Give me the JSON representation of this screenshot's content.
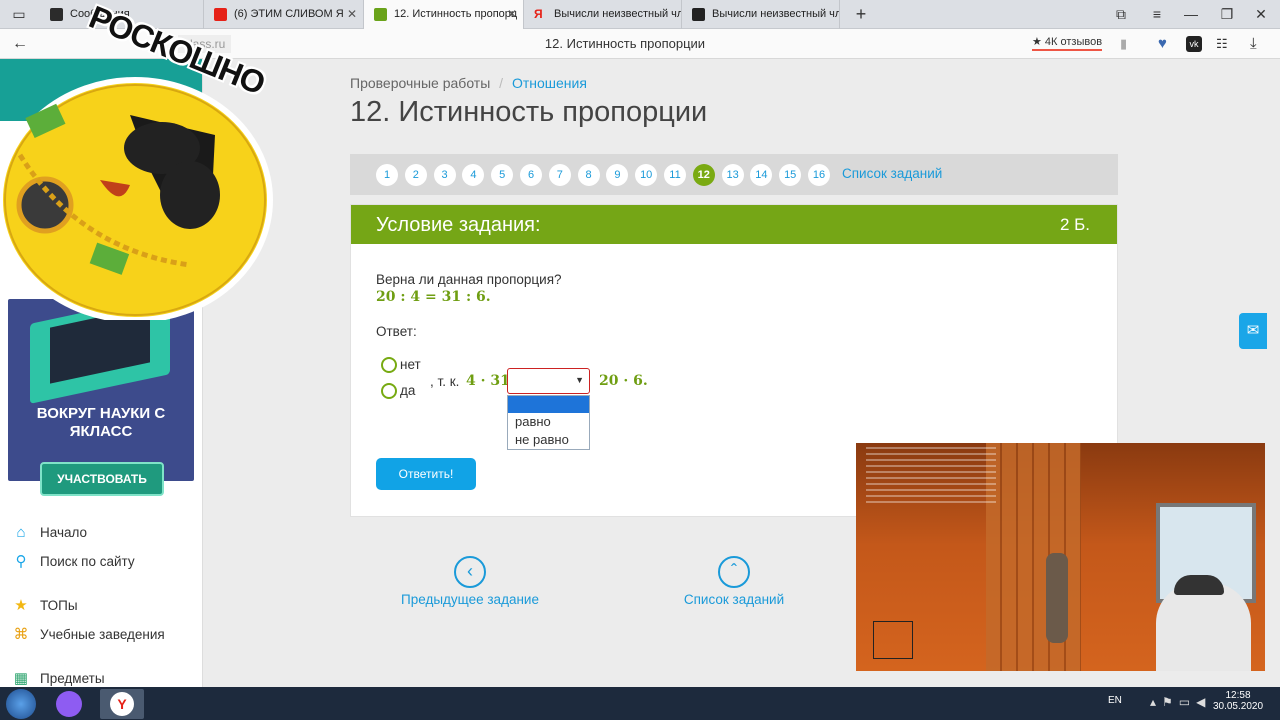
{
  "browser": {
    "tabs": [
      {
        "title": "Сообщения",
        "color": "#2b2b2b"
      },
      {
        "title": "(6) ЭТИМ СЛИВОМ Я",
        "color": "#e62117"
      },
      {
        "title": "12. Истинность пропорц",
        "color": "#6aa31a"
      },
      {
        "title": "Вычисли неизвестный чле",
        "color": "#e62117"
      },
      {
        "title": "Вычисли неизвестный чле",
        "color": "#222222"
      }
    ],
    "url_host": "klass.ru",
    "page_title": "12. Истинность пропорции",
    "reviews_label": "★ 4К отзывов"
  },
  "sidebar": {
    "promo_title": "ВОКРУГ НАУКИ С ЯКЛАСС",
    "promo_button": "УЧАСТВОВАТЬ",
    "menu": [
      {
        "label": "Начало",
        "icon": "home-icon"
      },
      {
        "label": "Поиск по сайту",
        "icon": "search-icon"
      },
      {
        "label": "ТОПы",
        "icon": "star-icon"
      },
      {
        "label": "Учебные заведения",
        "icon": "school-icon"
      },
      {
        "label": "Предметы",
        "icon": "subjects-icon"
      }
    ]
  },
  "breadcrumb": {
    "root": "Проверочные работы",
    "separator": "/",
    "current": "Отношения"
  },
  "title": "12. Истинность пропорции",
  "pager": {
    "pages": [
      "1",
      "2",
      "3",
      "4",
      "5",
      "6",
      "7",
      "8",
      "9",
      "10",
      "11",
      "12",
      "13",
      "14",
      "15",
      "16"
    ],
    "current": "12",
    "list_link": "Список заданий"
  },
  "task": {
    "header": "Условие задания:",
    "points": "2 Б.",
    "question": "Верна ли данная пропорция?",
    "proportion": "20 : 4 = 31 : 6.",
    "answer_label": "Ответ:",
    "options": [
      "нет",
      "да"
    ],
    "because": ", т. к.",
    "left_expr": "4 · 31",
    "right_expr": "20 · 6.",
    "dropdown_options": [
      "",
      "равно",
      "не равно"
    ],
    "submit": "Ответить!"
  },
  "nav": {
    "prev": "Предыдущее задание",
    "list": "Список заданий"
  },
  "sticker_text": "РОСКОШНО",
  "taskbar": {
    "lang": "EN",
    "time": "12:58",
    "date": "30.05.2020"
  }
}
